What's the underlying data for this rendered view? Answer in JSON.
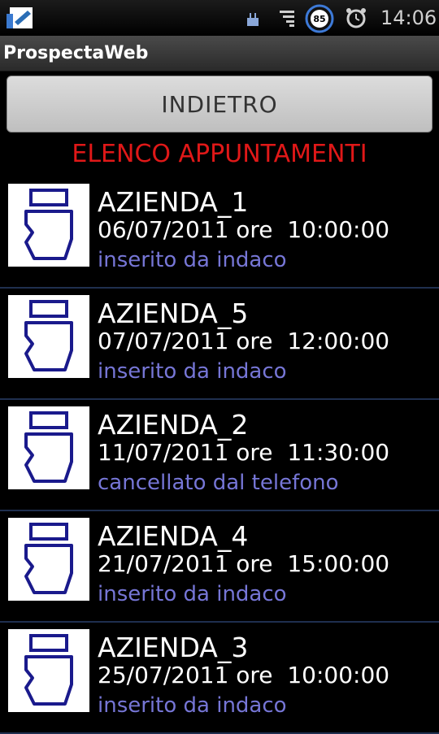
{
  "status_bar": {
    "time": "14:06",
    "battery_level": "85",
    "icons": [
      "app-icon",
      "usb-icon",
      "signal-icon",
      "battery-icon",
      "alarm-icon"
    ]
  },
  "app": {
    "title": "ProspectaWeb"
  },
  "toolbar": {
    "back_label": "INDIETRO"
  },
  "list": {
    "heading": "ELENCO APPUNTAMENTI",
    "heading_color": "#e01818",
    "status_color": "#7676d6",
    "items": [
      {
        "company": "AZIENDA_1",
        "datetime": "06/07/2011 ore  10:00:00",
        "status": "inserito da indaco",
        "icon": "document-icon"
      },
      {
        "company": "AZIENDA_5",
        "datetime": "07/07/2011 ore  12:00:00",
        "status": "inserito da indaco",
        "icon": "document-icon"
      },
      {
        "company": "AZIENDA_2",
        "datetime": "11/07/2011 ore  11:30:00",
        "status": "cancellato dal telefono",
        "icon": "document-icon"
      },
      {
        "company": "AZIENDA_4",
        "datetime": "21/07/2011 ore  15:00:00",
        "status": "inserito da indaco",
        "icon": "document-icon"
      },
      {
        "company": "AZIENDA_3",
        "datetime": "25/07/2011 ore  10:00:00",
        "status": "inserito da indaco",
        "icon": "document-icon"
      }
    ]
  }
}
